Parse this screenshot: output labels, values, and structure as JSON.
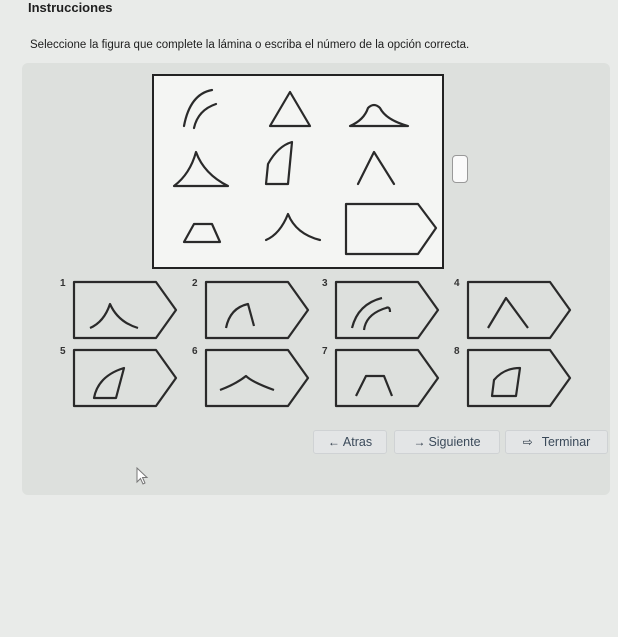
{
  "page": {
    "title": "Instrucciones",
    "instruction": "Seleccione la figura que complete la lámina o escriba el número de la opción correcta."
  },
  "options": [
    {
      "number": "1",
      "shape": "chevron-peak"
    },
    {
      "number": "2",
      "shape": "arc-flag"
    },
    {
      "number": "3",
      "shape": "double-arc"
    },
    {
      "number": "4",
      "shape": "caret"
    },
    {
      "number": "5",
      "shape": "curved-quad"
    },
    {
      "number": "6",
      "shape": "flat-peak"
    },
    {
      "number": "7",
      "shape": "trapezoid-open"
    },
    {
      "number": "8",
      "shape": "curved-quad-outline"
    }
  ],
  "buttons": {
    "back": {
      "label": "Atras",
      "icon": "arrow-left-icon"
    },
    "next": {
      "label": "Siguiente",
      "icon": "arrow-right-icon"
    },
    "finish": {
      "label": "Terminar",
      "icon": "exit-icon"
    }
  },
  "answer": {
    "value": ""
  },
  "colors": {
    "page_bg": "#e9ebe9",
    "panel_bg": "#dde0dd",
    "button_text": "#3b4a5a"
  }
}
